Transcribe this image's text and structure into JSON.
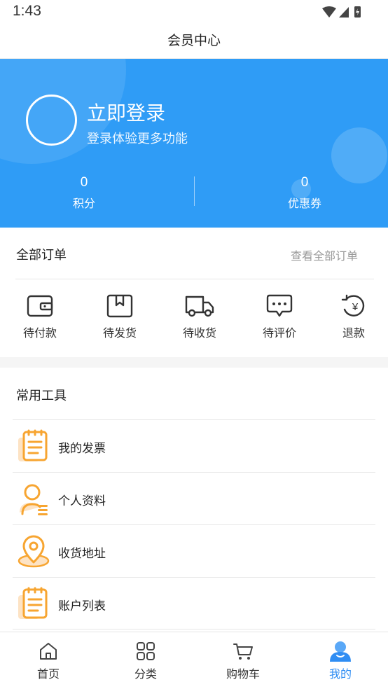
{
  "status_bar": {
    "time": "1:43"
  },
  "header": {
    "title": "会员中心"
  },
  "profile": {
    "login_title": "立即登录",
    "login_subtitle": "登录体验更多功能",
    "stats": [
      {
        "value": "0",
        "label": "积分"
      },
      {
        "value": "0",
        "label": "优惠券"
      }
    ]
  },
  "orders": {
    "title": "全部订单",
    "view_all": "查看全部订单",
    "items": [
      {
        "label": "待付款",
        "icon": "wallet-icon"
      },
      {
        "label": "待发货",
        "icon": "box-icon"
      },
      {
        "label": "待收货",
        "icon": "truck-icon"
      },
      {
        "label": "待评价",
        "icon": "comment-icon"
      },
      {
        "label": "退款",
        "icon": "refund-icon"
      }
    ]
  },
  "tools": {
    "title": "常用工具",
    "items": [
      {
        "label": "我的发票",
        "icon": "invoice-icon"
      },
      {
        "label": "个人资料",
        "icon": "profile-icon"
      },
      {
        "label": "收货地址",
        "icon": "location-icon"
      },
      {
        "label": "账户列表",
        "icon": "account-list-icon"
      }
    ]
  },
  "tab_bar": {
    "items": [
      {
        "label": "首页",
        "icon": "home-icon",
        "active": false
      },
      {
        "label": "分类",
        "icon": "category-icon",
        "active": false
      },
      {
        "label": "购物车",
        "icon": "cart-icon",
        "active": false
      },
      {
        "label": "我的",
        "icon": "user-icon",
        "active": true
      }
    ]
  },
  "colors": {
    "brand_blue": "#2f9cf6",
    "active_tab": "#2f8df3",
    "tool_orange": "#f7a531"
  }
}
